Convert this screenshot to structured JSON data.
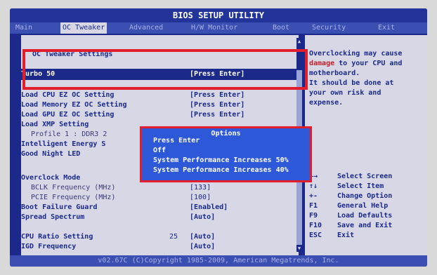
{
  "bios": {
    "title": "BIOS SETUP UTILITY",
    "tabs": [
      "Main",
      "OC Tweaker",
      "Advanced",
      "H/W Monitor",
      "Boot",
      "Security",
      "Exit"
    ],
    "active_tab_index": 1
  },
  "left": {
    "section_title": "OC Tweaker Settings",
    "turbo_label": "Turbo 50",
    "turbo_value": "[Press Enter]",
    "rows": [
      {
        "label": "Load CPU EZ OC Setting",
        "value": "[Press Enter]"
      },
      {
        "label": "Load Memory EZ OC Setting",
        "value": "[Press Enter]"
      },
      {
        "label": "Load GPU EZ OC Setting",
        "value": "[Press Enter]"
      },
      {
        "label": "Load XMP Setting",
        "value": ""
      },
      {
        "label": "Profile 1 : DDR3 2",
        "value": ""
      },
      {
        "label": "Intelligent Energy S",
        "value": ""
      },
      {
        "label": "Good Night LED",
        "value": ""
      }
    ],
    "overclock_rows": [
      {
        "label": "Overclock Mode",
        "value": ""
      },
      {
        "label": "BCLK Frequency (MHz)",
        "value": "[133]"
      },
      {
        "label": "PCIE Frequency (MHz)",
        "value": "[100]"
      },
      {
        "label": "Boot Failure Guard",
        "value": "[Enabled]"
      },
      {
        "label": "Spread Spectrum",
        "value": "[Auto]"
      }
    ],
    "cpu_ratio_label": "CPU Ratio Setting",
    "cpu_ratio_num": "25",
    "cpu_ratio_value": "[Auto]",
    "igd_label": "IGD Frequency",
    "igd_value": "[Auto]"
  },
  "help": {
    "line1": "Overclocking may cause",
    "warn": "damage",
    "line2_rest": " to your CPU and",
    "line3": "motherboard.",
    "line4": "It should be done at",
    "line5": "your own risk and",
    "line6": "expense."
  },
  "keys": [
    {
      "key": "←→",
      "desc": "Select Screen"
    },
    {
      "key": "↑↓",
      "desc": "Select Item"
    },
    {
      "key": "+-",
      "desc": "Change Option"
    },
    {
      "key": "F1",
      "desc": "General Help"
    },
    {
      "key": "F9",
      "desc": "Load Defaults"
    },
    {
      "key": "F10",
      "desc": "Save and Exit"
    },
    {
      "key": "ESC",
      "desc": "Exit"
    }
  ],
  "popup": {
    "header": "Options",
    "options": [
      "Press Enter",
      "Off",
      "System Performance Increases 50%",
      "System Performance Increases 40%"
    ]
  },
  "footer": "v02.67C (C)Copyright 1985-2009, American Megatrends, Inc."
}
